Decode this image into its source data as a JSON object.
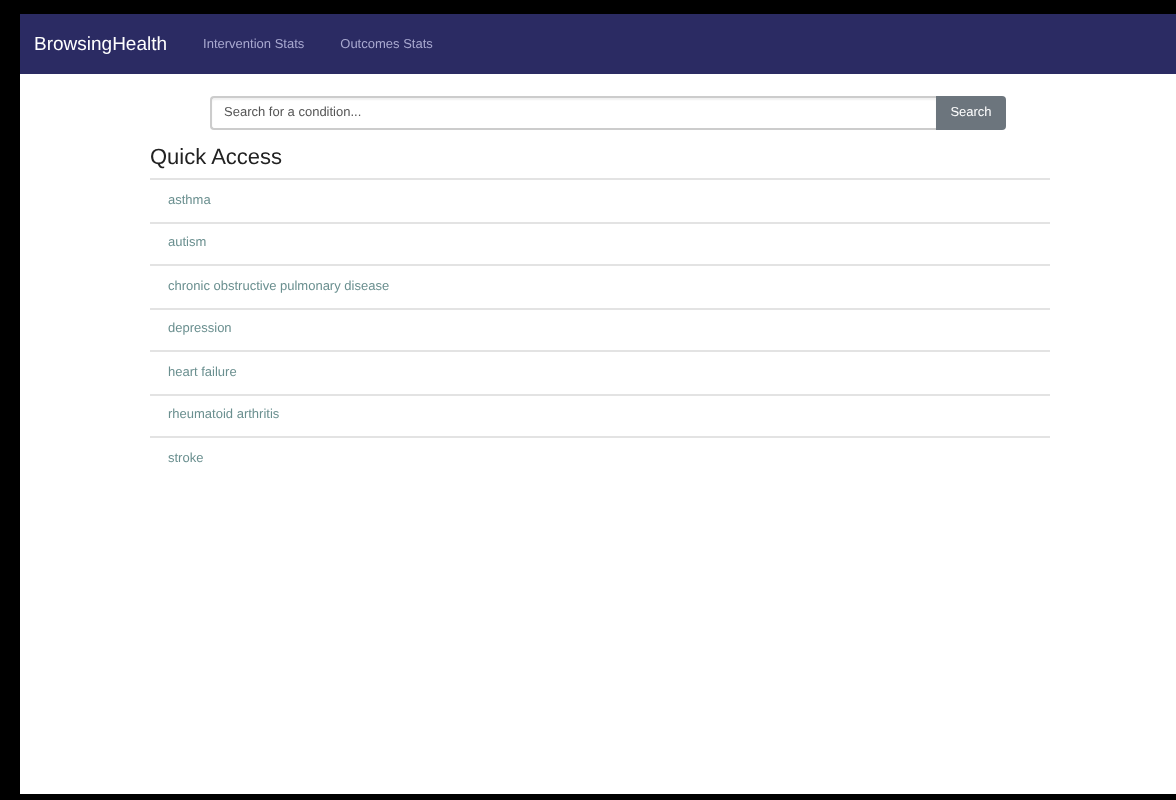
{
  "navbar": {
    "brand": "BrowsingHealth",
    "links": [
      "Intervention Stats",
      "Outcomes Stats"
    ]
  },
  "search": {
    "placeholder": "Search for a condition...",
    "button": "Search"
  },
  "quick_access": {
    "title": "Quick Access",
    "items": [
      "asthma",
      "autism",
      "chronic obstructive pulmonary disease",
      "depression",
      "heart failure",
      "rheumatoid arthritis",
      "stroke"
    ]
  }
}
